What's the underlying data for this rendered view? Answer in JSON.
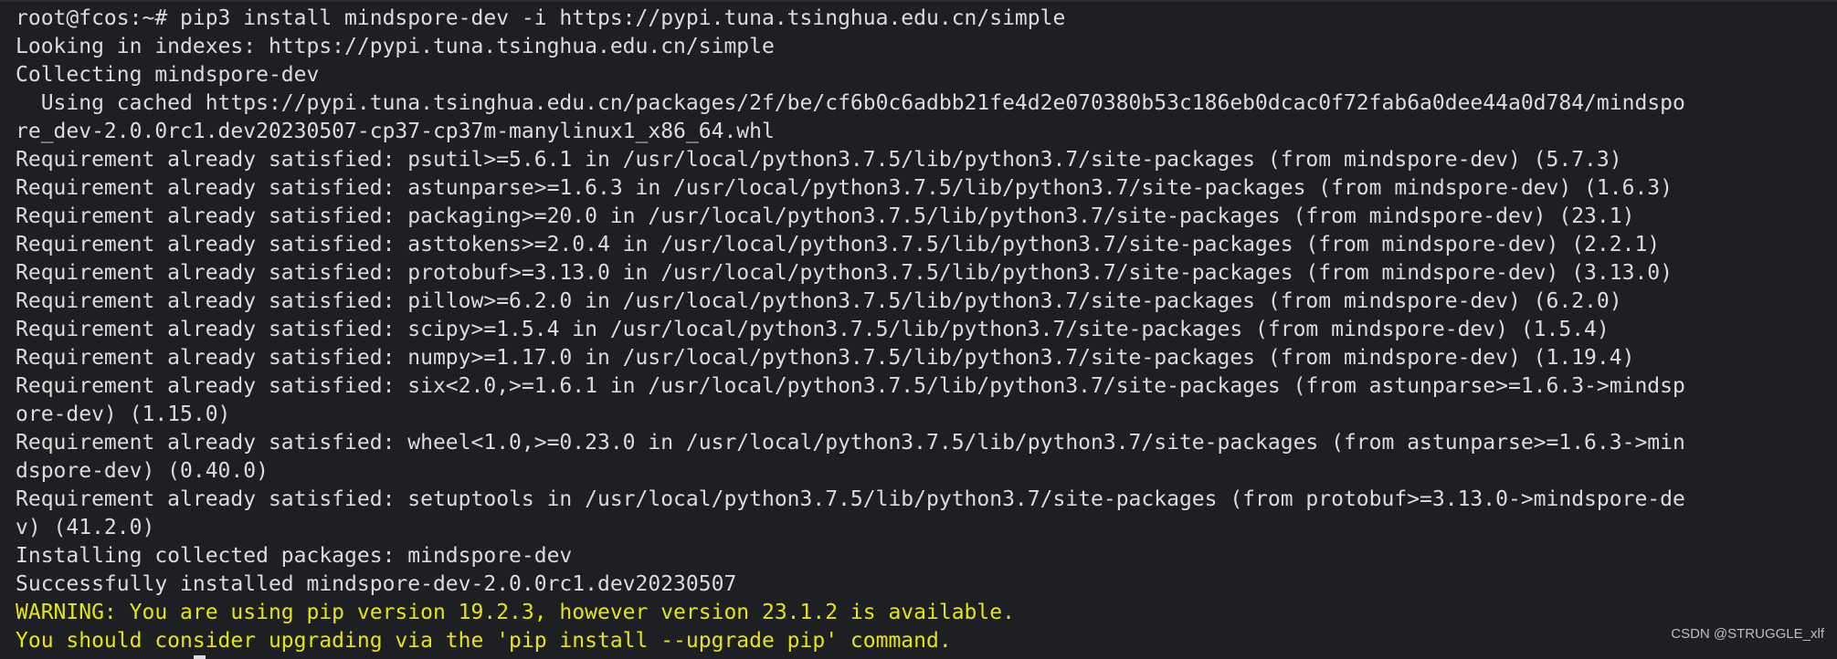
{
  "terminal": {
    "lines": [
      {
        "text": "root@fcos:~# pip3 install mindspore-dev -i https://pypi.tuna.tsinghua.edu.cn/simple",
        "style": "normal"
      },
      {
        "text": "Looking in indexes: https://pypi.tuna.tsinghua.edu.cn/simple",
        "style": "normal"
      },
      {
        "text": "Collecting mindspore-dev",
        "style": "normal"
      },
      {
        "text": "  Using cached https://pypi.tuna.tsinghua.edu.cn/packages/2f/be/cf6b0c6adbb21fe4d2e070380b53c186eb0dcac0f72fab6a0dee44a0d784/mindspo",
        "style": "normal"
      },
      {
        "text": "re_dev-2.0.0rc1.dev20230507-cp37-cp37m-manylinux1_x86_64.whl",
        "style": "normal"
      },
      {
        "text": "Requirement already satisfied: psutil>=5.6.1 in /usr/local/python3.7.5/lib/python3.7/site-packages (from mindspore-dev) (5.7.3)",
        "style": "normal"
      },
      {
        "text": "Requirement already satisfied: astunparse>=1.6.3 in /usr/local/python3.7.5/lib/python3.7/site-packages (from mindspore-dev) (1.6.3)",
        "style": "normal"
      },
      {
        "text": "Requirement already satisfied: packaging>=20.0 in /usr/local/python3.7.5/lib/python3.7/site-packages (from mindspore-dev) (23.1)",
        "style": "normal"
      },
      {
        "text": "Requirement already satisfied: asttokens>=2.0.4 in /usr/local/python3.7.5/lib/python3.7/site-packages (from mindspore-dev) (2.2.1)",
        "style": "normal"
      },
      {
        "text": "Requirement already satisfied: protobuf>=3.13.0 in /usr/local/python3.7.5/lib/python3.7/site-packages (from mindspore-dev) (3.13.0)",
        "style": "normal"
      },
      {
        "text": "Requirement already satisfied: pillow>=6.2.0 in /usr/local/python3.7.5/lib/python3.7/site-packages (from mindspore-dev) (6.2.0)",
        "style": "normal"
      },
      {
        "text": "Requirement already satisfied: scipy>=1.5.4 in /usr/local/python3.7.5/lib/python3.7/site-packages (from mindspore-dev) (1.5.4)",
        "style": "normal"
      },
      {
        "text": "Requirement already satisfied: numpy>=1.17.0 in /usr/local/python3.7.5/lib/python3.7/site-packages (from mindspore-dev) (1.19.4)",
        "style": "normal"
      },
      {
        "text": "Requirement already satisfied: six<2.0,>=1.6.1 in /usr/local/python3.7.5/lib/python3.7/site-packages (from astunparse>=1.6.3->mindsp",
        "style": "normal"
      },
      {
        "text": "ore-dev) (1.15.0)",
        "style": "normal"
      },
      {
        "text": "Requirement already satisfied: wheel<1.0,>=0.23.0 in /usr/local/python3.7.5/lib/python3.7/site-packages (from astunparse>=1.6.3->min",
        "style": "normal"
      },
      {
        "text": "dspore-dev) (0.40.0)",
        "style": "normal"
      },
      {
        "text": "Requirement already satisfied: setuptools in /usr/local/python3.7.5/lib/python3.7/site-packages (from protobuf>=3.13.0->mindspore-de",
        "style": "normal"
      },
      {
        "text": "v) (41.2.0)",
        "style": "normal"
      },
      {
        "text": "Installing collected packages: mindspore-dev",
        "style": "normal"
      },
      {
        "text": "Successfully installed mindspore-dev-2.0.0rc1.dev20230507",
        "style": "normal"
      },
      {
        "text": "WARNING: You are using pip version 19.2.3, however version 23.1.2 is available.",
        "style": "warn"
      },
      {
        "text": "You should consider upgrading via the 'pip install --upgrade pip' command.",
        "style": "warn"
      }
    ]
  },
  "watermark": "CSDN @STRUGGLE_xlf",
  "colors": {
    "background": "#1e1f22",
    "text": "#dcdcdc",
    "warning": "#e5e510"
  }
}
